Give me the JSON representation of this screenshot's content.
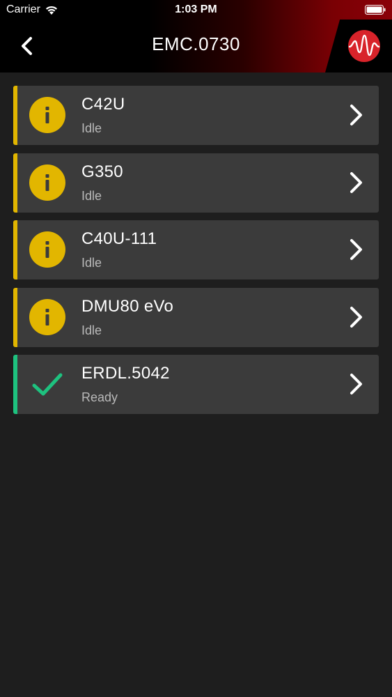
{
  "status_bar": {
    "carrier": "Carrier",
    "time": "1:03 PM"
  },
  "nav": {
    "title": "EMC.0730",
    "back_icon": "chevron-left-icon",
    "logo_icon": "waveform-logo-icon"
  },
  "colors": {
    "idle_accent": "#e2b600",
    "ready_accent": "#1ec27f",
    "card_bg": "#3b3b3b",
    "page_bg": "#1e1e1e",
    "logo_red": "#d8232a"
  },
  "machines": [
    {
      "name": "C42U",
      "status": "Idle",
      "icon": "info-icon"
    },
    {
      "name": "G350",
      "status": "Idle",
      "icon": "info-icon"
    },
    {
      "name": "C40U-111",
      "status": "Idle",
      "icon": "info-icon"
    },
    {
      "name": "DMU80 eVo",
      "status": "Idle",
      "icon": "info-icon"
    },
    {
      "name": "ERDL.5042",
      "status": "Ready",
      "icon": "check-icon"
    }
  ]
}
